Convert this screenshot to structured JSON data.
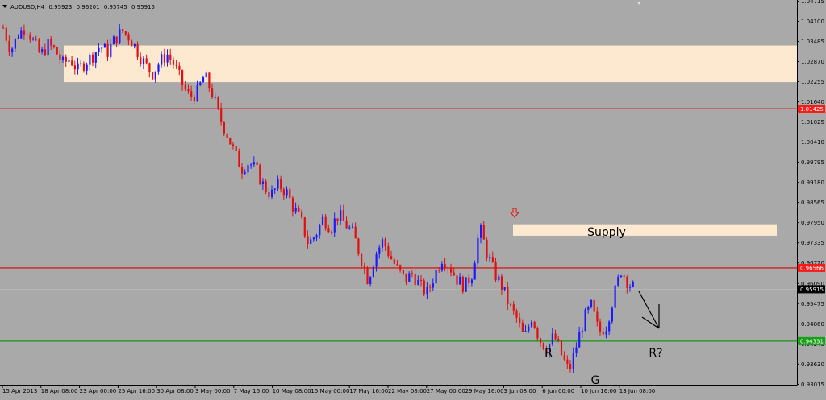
{
  "header": {
    "symbol": "AUDUSD,H4",
    "ohlc": [
      "0.95923",
      "0.96201",
      "0.95745",
      "0.95915"
    ],
    "menu_icon": "triangle-down-icon"
  },
  "colors": {
    "background": "#a9a9a9",
    "bull_candle": "#1a1aff",
    "bear_candle": "#e01010",
    "zone_fill": "#fde9d0",
    "resistance_line": "#e00000",
    "support_line": "#119911",
    "price_tag_red": "#ff1a1a",
    "price_tag_green": "#18a018",
    "current_price_tag": "#000000",
    "annotation_arrow": "#000000",
    "sell_arrow": "#e01010"
  },
  "chart_data": {
    "type": "candlestick",
    "title": "",
    "ylim": [
      0.93,
      1.0475
    ],
    "y_ticks": [
      "1.04715",
      "1.04100",
      "1.03485",
      "1.02870",
      "1.02255",
      "1.01640",
      "1.01025",
      "1.00410",
      "0.99795",
      "0.99180",
      "0.98565",
      "0.97950",
      "0.97335",
      "0.96720",
      "0.96090",
      "0.95475",
      "0.94860",
      "0.94245",
      "0.93630",
      "0.93015"
    ],
    "x_ticks": [
      "15 Apr 2013",
      "18 Apr 08:00",
      "23 Apr 00:00",
      "25 Apr 16:00",
      "30 Apr 08:00",
      "3 May 00:00",
      "7 May 16:00",
      "10 May 08:00",
      "15 May 00:00",
      "17 May 16:00",
      "22 May 08:00",
      "27 May 00:00",
      "29 May 16:00",
      "3 Jun 08:00",
      "6 Jun 00:00",
      "10 Jun 16:00",
      "13 Jun 08:00"
    ],
    "close_path": [
      1.039,
      1.032,
      1.037,
      1.0395,
      1.035,
      1.0305,
      1.034,
      1.032,
      1.028,
      1.0295,
      1.026,
      1.0285,
      1.0305,
      1.0335,
      1.0315,
      1.0355,
      1.038,
      1.036,
      1.032,
      1.028,
      1.025,
      1.0285,
      1.031,
      1.0275,
      1.022,
      1.018,
      1.019,
      1.0245,
      1.0195,
      1.012,
      1.007,
      1.001,
      0.996,
      0.998,
      0.9955,
      0.9905,
      0.988,
      0.991,
      0.989,
      0.984,
      0.98,
      0.973,
      0.976,
      0.981,
      0.978,
      0.982,
      0.979,
      0.976,
      0.969,
      0.962,
      0.97,
      0.974,
      0.969,
      0.965,
      0.962,
      0.964,
      0.96,
      0.958,
      0.964,
      0.969,
      0.966,
      0.962,
      0.96,
      0.964,
      0.978,
      0.97,
      0.964,
      0.96,
      0.954,
      0.95,
      0.944,
      0.951,
      0.944,
      0.941,
      0.945,
      0.939,
      0.934,
      0.942,
      0.95,
      0.954,
      0.946,
      0.948,
      0.957,
      0.965,
      0.961,
      0.959
    ],
    "zones": [
      {
        "name": "upper-zone",
        "from": 1.0224,
        "to": 1.0336,
        "label": ""
      },
      {
        "name": "supply-zone",
        "from": 0.9755,
        "to": 0.979,
        "label": "Supply"
      }
    ],
    "horizontal_lines": [
      {
        "name": "resistance-1",
        "value": 1.01425,
        "label": "1.01425",
        "color": "red"
      },
      {
        "name": "resistance-2",
        "value": 0.96566,
        "label": "0.96566",
        "color": "red"
      },
      {
        "name": "support",
        "value": 0.94331,
        "label": "0.94331",
        "color": "green"
      }
    ],
    "current_price": {
      "value": 0.95915,
      "label": "0.95915"
    },
    "annotations": [
      {
        "name": "label-r",
        "text": "R"
      },
      {
        "name": "label-r-question",
        "text": "R?"
      },
      {
        "name": "label-g",
        "text": "G"
      }
    ]
  }
}
